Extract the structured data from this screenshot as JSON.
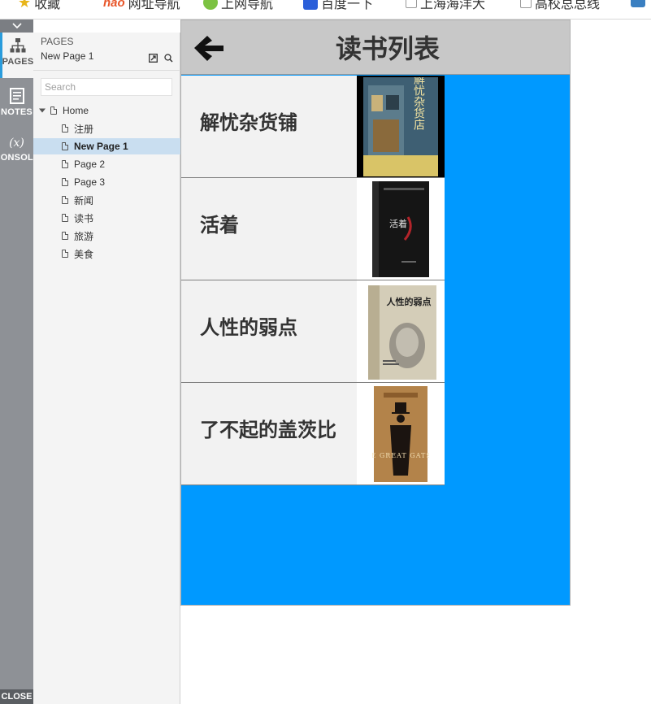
{
  "bookmarks": [
    {
      "label": "收藏"
    },
    {
      "label": "网址导航",
      "prefix": "hao"
    },
    {
      "label": "上网导航"
    },
    {
      "label": "百度一下"
    },
    {
      "label": "上海海洋大"
    },
    {
      "label": "高校总总线"
    }
  ],
  "rail": {
    "pages_label": "PAGES",
    "notes_label": "NOTES",
    "console_label": "CONSOLE",
    "console_symbol": "(x)",
    "close_label": "CLOSE"
  },
  "panel": {
    "title": "PAGES",
    "current_page": "New Page 1",
    "search_placeholder": "Search",
    "tree": [
      {
        "label": "Home",
        "level": 0,
        "expanded": true
      },
      {
        "label": "注册",
        "level": 1
      },
      {
        "label": "New Page 1",
        "level": 1,
        "selected": true
      },
      {
        "label": "Page 2",
        "level": 1
      },
      {
        "label": "Page 3",
        "level": 1
      },
      {
        "label": "新闻",
        "level": 1
      },
      {
        "label": "读书",
        "level": 1
      },
      {
        "label": "旅游",
        "level": 1
      },
      {
        "label": "美食",
        "level": 1
      }
    ]
  },
  "screen": {
    "title": "读书列表",
    "books": [
      {
        "title": "解忧杂货铺",
        "cover_text": "解忧杂货店"
      },
      {
        "title": "活着",
        "cover_text": "活着"
      },
      {
        "title": "人性的弱点",
        "cover_text": "人性的弱点"
      },
      {
        "title": "了不起的盖茨比",
        "cover_text": "THE GREAT GATSBY"
      }
    ]
  },
  "colors": {
    "canvas_bg": "#0099ff",
    "header_bg": "#c8c8c8",
    "row_bg": "#f2f2f2",
    "selection": "#c9def0",
    "rail_bg": "#8e9196"
  }
}
